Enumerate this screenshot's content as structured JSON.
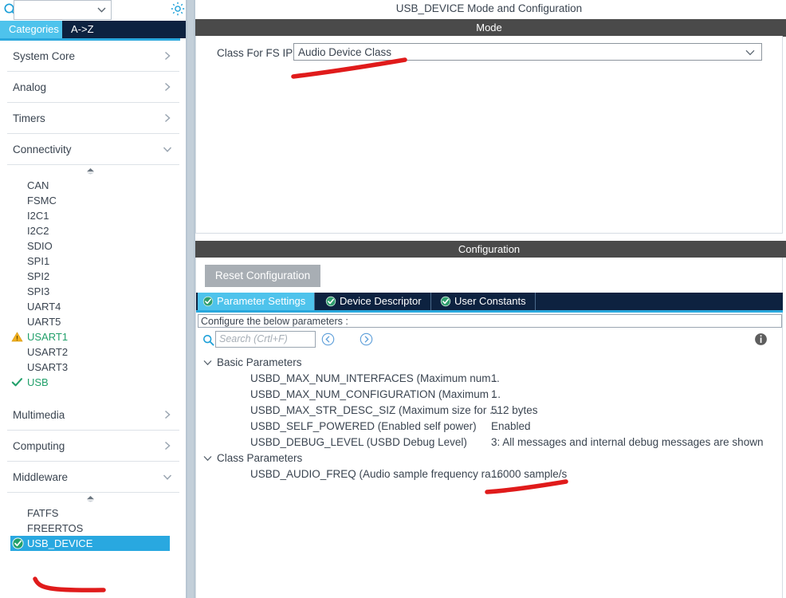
{
  "left_panel": {
    "search": {
      "value": "",
      "placeholder": ""
    },
    "gear_icon": "gear-icon",
    "tabs": [
      {
        "label": "Categories",
        "active": true
      },
      {
        "label": "A->Z",
        "active": false
      }
    ],
    "categories": [
      {
        "label": "System Core",
        "expanded": false
      },
      {
        "label": "Analog",
        "expanded": false
      },
      {
        "label": "Timers",
        "expanded": false
      },
      {
        "label": "Connectivity",
        "expanded": true
      }
    ],
    "connectivity_items": [
      {
        "label": "CAN",
        "status": "none"
      },
      {
        "label": "FSMC",
        "status": "none"
      },
      {
        "label": "I2C1",
        "status": "none"
      },
      {
        "label": "I2C2",
        "status": "none"
      },
      {
        "label": "SDIO",
        "status": "none"
      },
      {
        "label": "SPI1",
        "status": "none"
      },
      {
        "label": "SPI2",
        "status": "none"
      },
      {
        "label": "SPI3",
        "status": "none"
      },
      {
        "label": "UART4",
        "status": "none"
      },
      {
        "label": "UART5",
        "status": "none"
      },
      {
        "label": "USART1",
        "status": "warning"
      },
      {
        "label": "USART2",
        "status": "none"
      },
      {
        "label": "USART3",
        "status": "none"
      },
      {
        "label": "USB",
        "status": "ok"
      }
    ],
    "categories_lower": [
      {
        "label": "Multimedia",
        "expanded": false
      },
      {
        "label": "Computing",
        "expanded": false
      },
      {
        "label": "Middleware",
        "expanded": true
      }
    ],
    "middleware_items": [
      {
        "label": "FATFS",
        "status": "none",
        "selected": false
      },
      {
        "label": "FREERTOS",
        "status": "none",
        "selected": false
      },
      {
        "label": "USB_DEVICE",
        "status": "ok",
        "selected": true
      }
    ]
  },
  "right_panel": {
    "title": "USB_DEVICE Mode and Configuration",
    "mode": {
      "header": "Mode",
      "class_label": "Class For FS IP",
      "class_value": "Audio Device Class"
    },
    "configuration": {
      "header": "Configuration",
      "reset_button": "Reset Configuration",
      "tabs": [
        {
          "label": "Parameter Settings",
          "active": true,
          "status": "ok"
        },
        {
          "label": "Device Descriptor",
          "active": false,
          "status": "ok"
        },
        {
          "label": "User Constants",
          "active": false,
          "status": "ok"
        }
      ],
      "configure_note": "Configure the below parameters :",
      "search_placeholder": "Search (Crtl+F)",
      "groups": [
        {
          "label": "Basic Parameters",
          "expanded": true,
          "rows": [
            {
              "name": "USBD_MAX_NUM_INTERFACES (Maximum num...",
              "value": "1"
            },
            {
              "name": "USBD_MAX_NUM_CONFIGURATION (Maximum ...",
              "value": "1"
            },
            {
              "name": "USBD_MAX_STR_DESC_SIZ (Maximum size for ...",
              "value": "512 bytes"
            },
            {
              "name": "USBD_SELF_POWERED (Enabled self power)",
              "value": "Enabled"
            },
            {
              "name": "USBD_DEBUG_LEVEL (USBD Debug Level)",
              "value": "3: All messages and internal debug messages are shown"
            }
          ]
        },
        {
          "label": "Class Parameters",
          "expanded": true,
          "rows": [
            {
              "name": "USBD_AUDIO_FREQ (Audio sample frequency ra...",
              "value": "16000 sample/s"
            }
          ]
        }
      ]
    }
  },
  "colors": {
    "accent_blue": "#29a8e0",
    "tab_navy": "#0d2240",
    "tab_active": "#4ec3ec",
    "header_gray": "#4a4a4a",
    "green_ok": "#22a06b",
    "warning_amber": "#f2b01e",
    "annotation_red": "#e01b1b"
  }
}
